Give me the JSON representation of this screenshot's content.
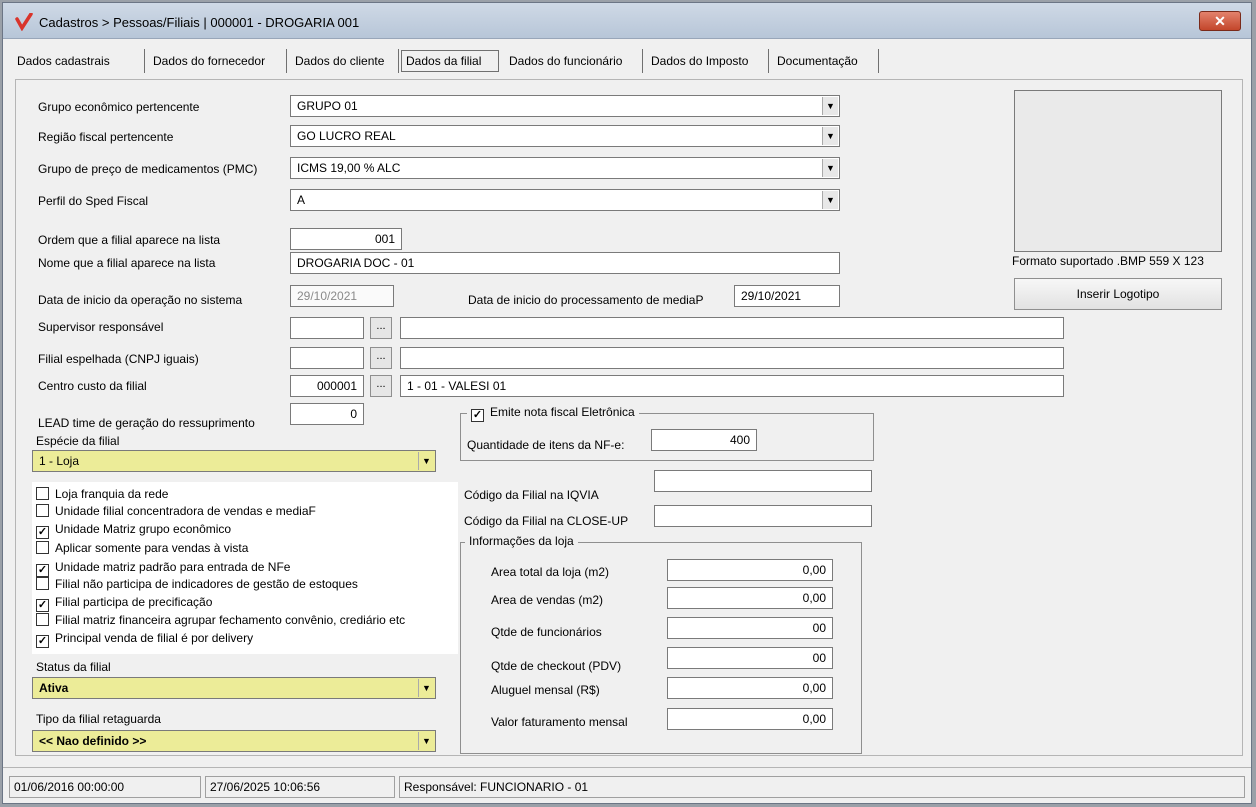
{
  "window": {
    "title": "Cadastros > Pessoas/Filiais | 000001 - DROGARIA 001",
    "close_label": "✕"
  },
  "tabs": [
    {
      "label": "Dados cadastrais"
    },
    {
      "label": "Dados do fornecedor"
    },
    {
      "label": "Dados do cliente"
    },
    {
      "label": "Dados da filial",
      "active": true
    },
    {
      "label": "Dados do funcionário"
    },
    {
      "label": "Dados do Imposto"
    },
    {
      "label": "Documentação"
    }
  ],
  "form": {
    "grupo_economico": {
      "label": "Grupo econômico pertencente",
      "value": "GRUPO 01"
    },
    "regiao_fiscal": {
      "label": "Região fiscal pertencente",
      "value": "GO LUCRO REAL"
    },
    "grupo_preco": {
      "label": "Grupo de preço de medicamentos (PMC)",
      "value": "ICMS 19,00 % ALC"
    },
    "perfil_sped": {
      "label": "Perfil do Sped Fiscal",
      "value": "A"
    },
    "ordem": {
      "label": "Ordem que a filial aparece na lista",
      "value": "001"
    },
    "nome_lista": {
      "label": "Nome que a filial aparece na lista",
      "value": "DROGARIA DOC - 01"
    },
    "data_inicio_op": {
      "label": "Data de inicio da operação no sistema",
      "value": "29/10/2021"
    },
    "data_inicio_proc": {
      "label": "Data de inicio do processamento de mediaP",
      "value": "29/10/2021"
    },
    "supervisor": {
      "label": "Supervisor responsável",
      "code": "",
      "desc": ""
    },
    "filial_espelhada": {
      "label": "Filial espelhada (CNPJ iguais)",
      "code": "",
      "desc": ""
    },
    "centro_custo": {
      "label": "Centro custo da filial",
      "code": "000001",
      "desc": "1 - 01 - VALESI 01"
    },
    "lead_time": {
      "label": "LEAD time de geração do ressuprimento",
      "value": "0"
    },
    "especie": {
      "label": "Espécie da filial",
      "value": "1 - Loja"
    },
    "status_filial": {
      "label": "Status da filial",
      "value": "Ativa"
    },
    "tipo_retaguarda": {
      "label": "Tipo da filial retaguarda",
      "value": "<< Nao definido >>"
    },
    "dots": "..."
  },
  "checkboxes": [
    {
      "label": "Loja franquia da rede",
      "checked": false
    },
    {
      "label": "Unidade filial concentradora de vendas e mediaF",
      "checked": false
    },
    {
      "label": "Unidade Matriz grupo econômico",
      "checked": true
    },
    {
      "label": "Aplicar somente para vendas à vista",
      "checked": false
    },
    {
      "label": "Unidade matriz padrão para entrada de NFe",
      "checked": true
    },
    {
      "label": "Filial não participa de indicadores de gestão de estoques",
      "checked": false
    },
    {
      "label": "Filial participa de precificação",
      "checked": true
    },
    {
      "label": "Filial matriz financeira agrupar fechamento convênio, crediário etc",
      "checked": false
    },
    {
      "label": "Principal venda de filial é por delivery",
      "checked": true
    }
  ],
  "nfe_group": {
    "title": "Emite nota fiscal Eletrônica",
    "checked": true,
    "qtd_label": "Quantidade de itens da NF-e:",
    "qtd_value": "400"
  },
  "codigos": {
    "iqvia_label": "Código da Filial na IQVIA",
    "iqvia_value": "",
    "closeup_label": "Código da Filial na CLOSE-UP",
    "closeup_value": ""
  },
  "info_loja": {
    "title": "Informações da loja",
    "rows": [
      {
        "label": "Area total da loja (m2)",
        "value": "0,00"
      },
      {
        "label": "Area de vendas (m2)",
        "value": "0,00"
      },
      {
        "label": "Qtde de funcionários",
        "value": "00"
      },
      {
        "label": "Qtde de checkout (PDV)",
        "value": "00"
      },
      {
        "label": "Aluguel mensal (R$)",
        "value": "0,00"
      },
      {
        "label": "Valor faturamento mensal",
        "value": "0,00"
      }
    ]
  },
  "logo": {
    "format_text": "Formato suportado .BMP 559 X 123",
    "insert_label": "Inserir Logotipo"
  },
  "statusbar": {
    "created": "01/06/2016 00:00:00",
    "updated": "27/06/2025 10:06:56",
    "responsavel": "Responsável: FUNCIONARIO - 01"
  },
  "colors": {
    "logo_red": "#d9342b",
    "highlight_yellow": "#ecec98"
  }
}
